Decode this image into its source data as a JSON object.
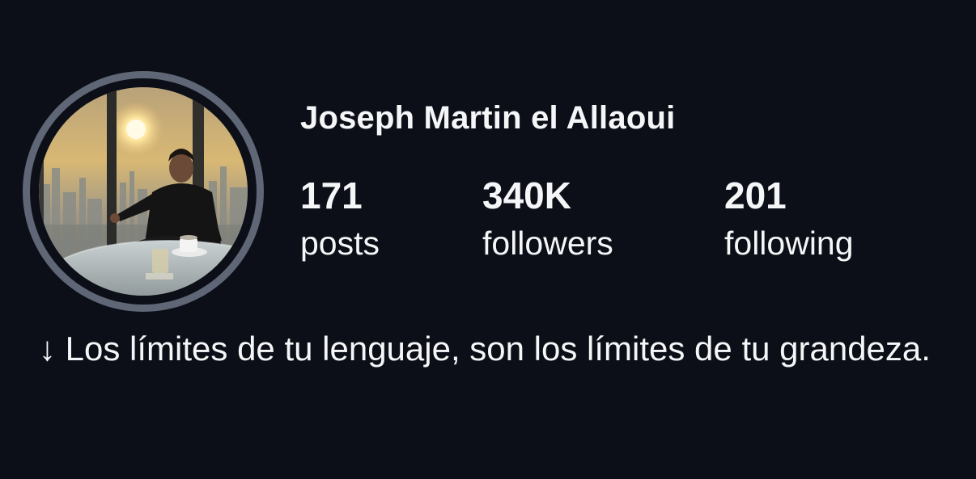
{
  "profile": {
    "name": "Joseph Martin el Allaoui",
    "avatar_alt": "profile-photo"
  },
  "stats": {
    "posts": {
      "count": "171",
      "label": "posts"
    },
    "followers": {
      "count": "340K",
      "label": "followers"
    },
    "following": {
      "count": "201",
      "label": "following"
    }
  },
  "bio": {
    "text": "↓ Los límites de tu lenguaje, son los límites de tu grandeza."
  },
  "colors": {
    "background": "#0c0f17",
    "text": "#f5f6f8",
    "avatar_ring": "#5f6675"
  }
}
